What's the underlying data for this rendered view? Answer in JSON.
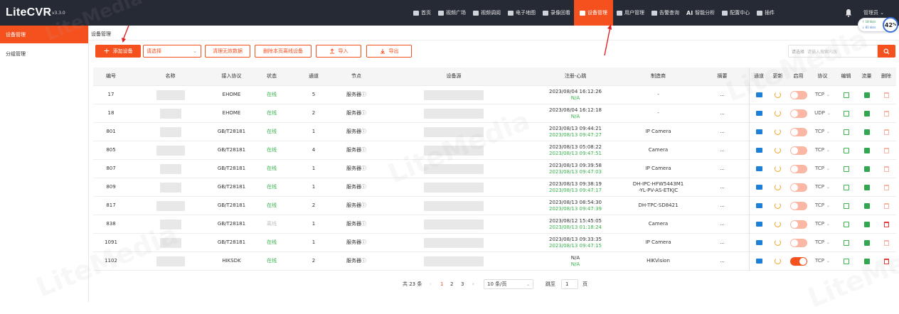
{
  "app": {
    "name": "LiteCVR",
    "version": "v3.3.0"
  },
  "nav": {
    "items": [
      {
        "label": "首页",
        "icon": "home-icon"
      },
      {
        "label": "视频广场",
        "icon": "play-icon"
      },
      {
        "label": "视频调阅",
        "icon": "grid-icon"
      },
      {
        "label": "电子地图",
        "icon": "map-pin-icon"
      },
      {
        "label": "录像回看",
        "icon": "video-icon"
      },
      {
        "label": "设备管理",
        "icon": "device-icon",
        "active": true
      },
      {
        "label": "用户管理",
        "icon": "user-icon"
      },
      {
        "label": "告警查询",
        "icon": "alarm-icon"
      },
      {
        "label": "智能分析",
        "icon": "ai-icon",
        "prefix": "AI"
      },
      {
        "label": "配置中心",
        "icon": "gear-icon"
      },
      {
        "label": "插件",
        "icon": "plugin-icon"
      }
    ],
    "user": "管理员",
    "net_up": "↑ 18 kb/s",
    "net_down": "↓ 81 kb/s",
    "cpu": "42",
    "cpu_unit": "%"
  },
  "sidebar": {
    "items": [
      {
        "label": "设备管理",
        "active": true
      },
      {
        "label": "分组管理"
      }
    ]
  },
  "breadcrumb": "设备管理",
  "toolbar": {
    "add": "添加设备",
    "select_value": "请选择",
    "clear_invalid": "清理无效数据",
    "delete_offline": "删除本页离线设备",
    "import": "导入",
    "export": "导出",
    "search_label": "请选择",
    "search_placeholder": "请输入搜索内容"
  },
  "table": {
    "headers": [
      "编号",
      "名称",
      "接入协议",
      "状态",
      "通道",
      "节点",
      "设备源",
      "注册-心跳",
      "制造商",
      "摘要",
      "通道",
      "更新",
      "启用",
      "协议",
      "编辑",
      "流量",
      "删除"
    ],
    "rows": [
      {
        "id": "17",
        "protocol": "EHOME",
        "status": "在线",
        "channels": "5",
        "node": "服务器",
        "reg": "2023/08/04 16:12:26",
        "hb": "N/A",
        "vendor": "-",
        "summary": "...",
        "enabled": false,
        "proto": "TCP",
        "can_delete": false
      },
      {
        "id": "18",
        "protocol": "EHOME",
        "status": "在线",
        "channels": "2",
        "node": "服务器",
        "reg": "2023/08/04 16:12:18",
        "hb": "N/A",
        "vendor": "-",
        "summary": "...",
        "enabled": false,
        "proto": "UDP",
        "can_delete": false
      },
      {
        "id": "801",
        "protocol": "GB/T28181",
        "status": "在线",
        "channels": "1",
        "node": "服务器",
        "reg": "2023/08/13 09:44:21",
        "hb": "2023/08/13 09:47:27",
        "vendor": "IP Camera",
        "summary": "...",
        "enabled": false,
        "proto": "TCP",
        "can_delete": false
      },
      {
        "id": "805",
        "protocol": "GB/T28181",
        "status": "在线",
        "channels": "4",
        "node": "服务器",
        "reg": "2023/08/13 05:08:22",
        "hb": "2023/08/13 09:47:51",
        "vendor": "Camera",
        "summary": "...",
        "enabled": false,
        "proto": "TCP",
        "can_delete": false
      },
      {
        "id": "807",
        "protocol": "GB/T28181",
        "status": "在线",
        "channels": "1",
        "node": "服务器",
        "reg": "2023/08/13 09:39:58",
        "hb": "2023/08/13 09:47:03",
        "vendor": "IP Camera",
        "summary": "...",
        "enabled": false,
        "proto": "TCP",
        "can_delete": false
      },
      {
        "id": "809",
        "protocol": "GB/T28181",
        "status": "在线",
        "channels": "1",
        "node": "服务器",
        "reg": "2023/08/13 09:38:19",
        "hb": "2023/08/13 09:47:17",
        "vendor": "DH-IPC-HFW5443M1\n-YL-PV-AS-ETKJC",
        "summary": "...",
        "enabled": false,
        "proto": "TCP",
        "can_delete": false
      },
      {
        "id": "817",
        "protocol": "GB/T28181",
        "status": "在线",
        "channels": "2",
        "node": "服务器",
        "reg": "2023/08/13 08:54:30",
        "hb": "2023/08/13 09:47:39",
        "vendor": "DH-TPC-SD8421",
        "summary": "...",
        "enabled": false,
        "proto": "TCP",
        "can_delete": false
      },
      {
        "id": "838",
        "protocol": "GB/T28181",
        "status": "离线",
        "channels": "1",
        "node": "服务器",
        "reg": "2023/08/12 15:45:05",
        "hb": "2023/08/13 01:18:24",
        "vendor": "Camera",
        "summary": "...",
        "enabled": false,
        "proto": "TCP",
        "can_delete": true
      },
      {
        "id": "1091",
        "protocol": "GB/T28181",
        "status": "在线",
        "channels": "1",
        "node": "服务器",
        "reg": "2023/08/13 09:33:35",
        "hb": "2023/08/13 09:47:15",
        "vendor": "IP Camera",
        "summary": "...",
        "enabled": false,
        "proto": "TCP",
        "can_delete": false
      },
      {
        "id": "1102",
        "protocol": "HIKSDK",
        "status": "在线",
        "channels": "2",
        "node": "服务器",
        "reg": "N/A",
        "hb": "N/A",
        "vendor": "HIKVision",
        "summary": "...",
        "enabled": true,
        "proto": "TCP",
        "can_delete": true
      }
    ]
  },
  "pagination": {
    "total": "共 23 条",
    "pages": [
      "1",
      "2",
      "3"
    ],
    "current": "1",
    "page_size": "10 条/页",
    "jump_label": "跳至",
    "jump_value": "1",
    "jump_suffix": "页"
  },
  "watermark": "LiteMedia",
  "colors": {
    "accent": "#f4511e",
    "topbar": "#262a35",
    "online": "#37b34a",
    "offline": "#c0c0c0"
  }
}
